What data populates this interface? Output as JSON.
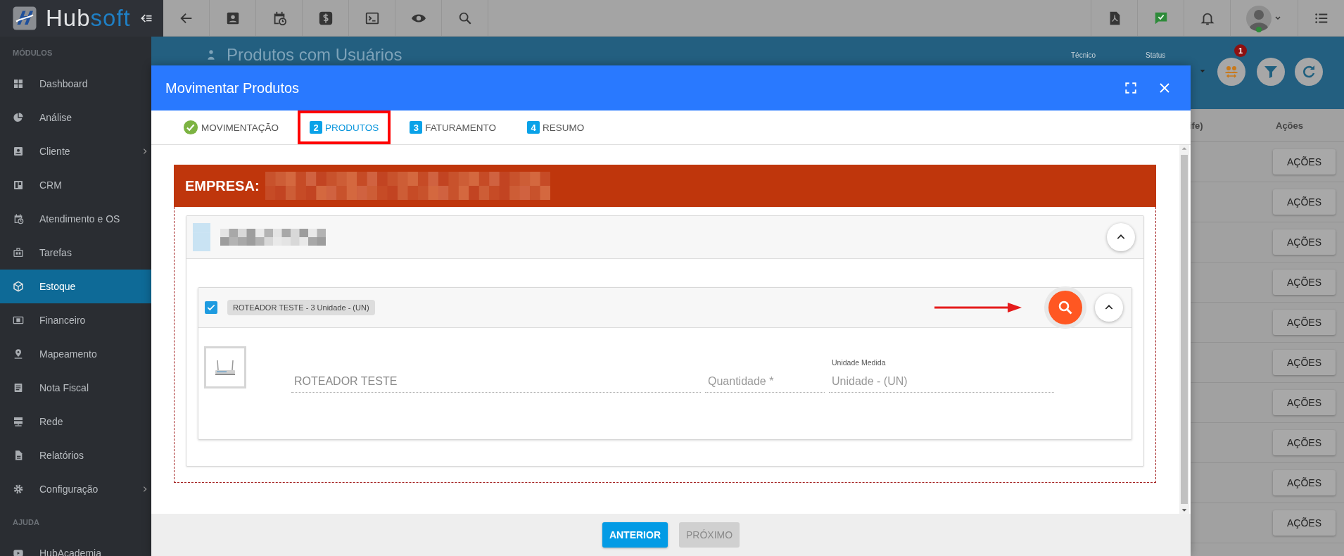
{
  "brand": {
    "name_start": "Hub",
    "name_end": "soft"
  },
  "sidebar": {
    "sections": [
      {
        "heading": "MÓDULOS",
        "items": [
          {
            "label": "Dashboard",
            "selected": false,
            "expandable": false
          },
          {
            "label": "Análise",
            "selected": false,
            "expandable": false
          },
          {
            "label": "Cliente",
            "selected": false,
            "expandable": true
          },
          {
            "label": "CRM",
            "selected": false,
            "expandable": false
          },
          {
            "label": "Atendimento e OS",
            "selected": false,
            "expandable": false
          },
          {
            "label": "Tarefas",
            "selected": false,
            "expandable": false
          },
          {
            "label": "Estoque",
            "selected": true,
            "expandable": false
          },
          {
            "label": "Financeiro",
            "selected": false,
            "expandable": false
          },
          {
            "label": "Mapeamento",
            "selected": false,
            "expandable": false
          },
          {
            "label": "Nota Fiscal",
            "selected": false,
            "expandable": false
          },
          {
            "label": "Rede",
            "selected": false,
            "expandable": false
          },
          {
            "label": "Relatórios",
            "selected": false,
            "expandable": false
          },
          {
            "label": "Configuração",
            "selected": false,
            "expandable": true
          }
        ]
      },
      {
        "heading": "AJUDA",
        "items": [
          {
            "label": "HubAcademia",
            "selected": false,
            "expandable": false
          }
        ]
      }
    ]
  },
  "background_page": {
    "title": "Produtos com Usuários",
    "filters": [
      {
        "label": "Técnico"
      },
      {
        "label": "Status"
      }
    ],
    "notification_count": "1",
    "table": {
      "columns": [
        {
          "label": "ife)"
        },
        {
          "label": "Ações"
        }
      ],
      "rows": [
        {
          "action": "AÇÕES"
        },
        {
          "action": "AÇÕES"
        },
        {
          "action": "AÇÕES"
        },
        {
          "action": "AÇÕES"
        },
        {
          "action": "AÇÕES"
        },
        {
          "action": "AÇÕES"
        },
        {
          "action": "AÇÕES"
        },
        {
          "action": "AÇÕES"
        },
        {
          "action": "AÇÕES"
        },
        {
          "action": "AÇÕES"
        }
      ]
    }
  },
  "modal": {
    "title": "Movimentar Produtos",
    "tabs": [
      {
        "label": "MOVIMENTAÇÃO",
        "done": true,
        "selected": false,
        "highlighted": false
      },
      {
        "number": "2",
        "label": "PRODUTOS",
        "done": false,
        "selected": true,
        "highlighted": true
      },
      {
        "number": "3",
        "label": "FATURAMENTO",
        "done": false,
        "selected": false,
        "highlighted": false
      },
      {
        "number": "4",
        "label": "RESUMO",
        "done": false,
        "selected": false,
        "highlighted": false
      }
    ],
    "company_label": "EMPRESA:",
    "product": {
      "checked": true,
      "chip": "ROTEADOR TESTE - 3 Unidade - (UN)",
      "name_value": "ROTEADOR TESTE",
      "quantity_placeholder": "Quantidade *",
      "unit_label": "Unidade Medida",
      "unit_value": "Unidade - (UN)"
    },
    "buttons": [
      {
        "label": "ANTERIOR",
        "disabled": false
      },
      {
        "label": "PRÓXIMO",
        "disabled": true
      }
    ]
  }
}
